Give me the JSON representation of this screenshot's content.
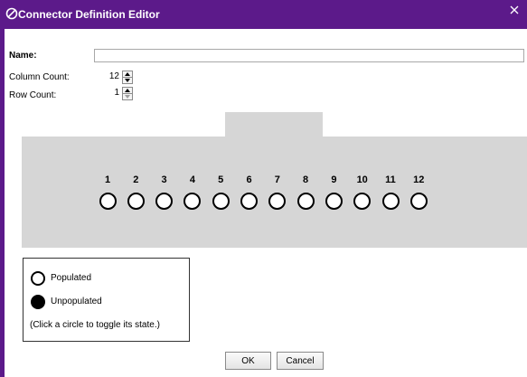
{
  "window": {
    "title": "Connector Definition Editor",
    "colors": {
      "titlebar": "#5c1a8a",
      "connector": "#d6d6d6"
    }
  },
  "form": {
    "name_label": "Name:",
    "name_value": "",
    "column_label": "Column Count:",
    "column_value": "12",
    "row_label": "Row Count:",
    "row_value": "1"
  },
  "connector": {
    "pins": [
      {
        "label": "1",
        "state": "populated"
      },
      {
        "label": "2",
        "state": "populated"
      },
      {
        "label": "3",
        "state": "populated"
      },
      {
        "label": "4",
        "state": "populated"
      },
      {
        "label": "5",
        "state": "populated"
      },
      {
        "label": "6",
        "state": "populated"
      },
      {
        "label": "7",
        "state": "populated"
      },
      {
        "label": "8",
        "state": "populated"
      },
      {
        "label": "9",
        "state": "populated"
      },
      {
        "label": "10",
        "state": "populated"
      },
      {
        "label": "11",
        "state": "populated"
      },
      {
        "label": "12",
        "state": "populated"
      }
    ]
  },
  "legend": {
    "populated": "Populated",
    "unpopulated": "Unpopulated",
    "note": "(Click a circle to toggle its state.)"
  },
  "buttons": {
    "ok": "OK",
    "cancel": "Cancel"
  }
}
